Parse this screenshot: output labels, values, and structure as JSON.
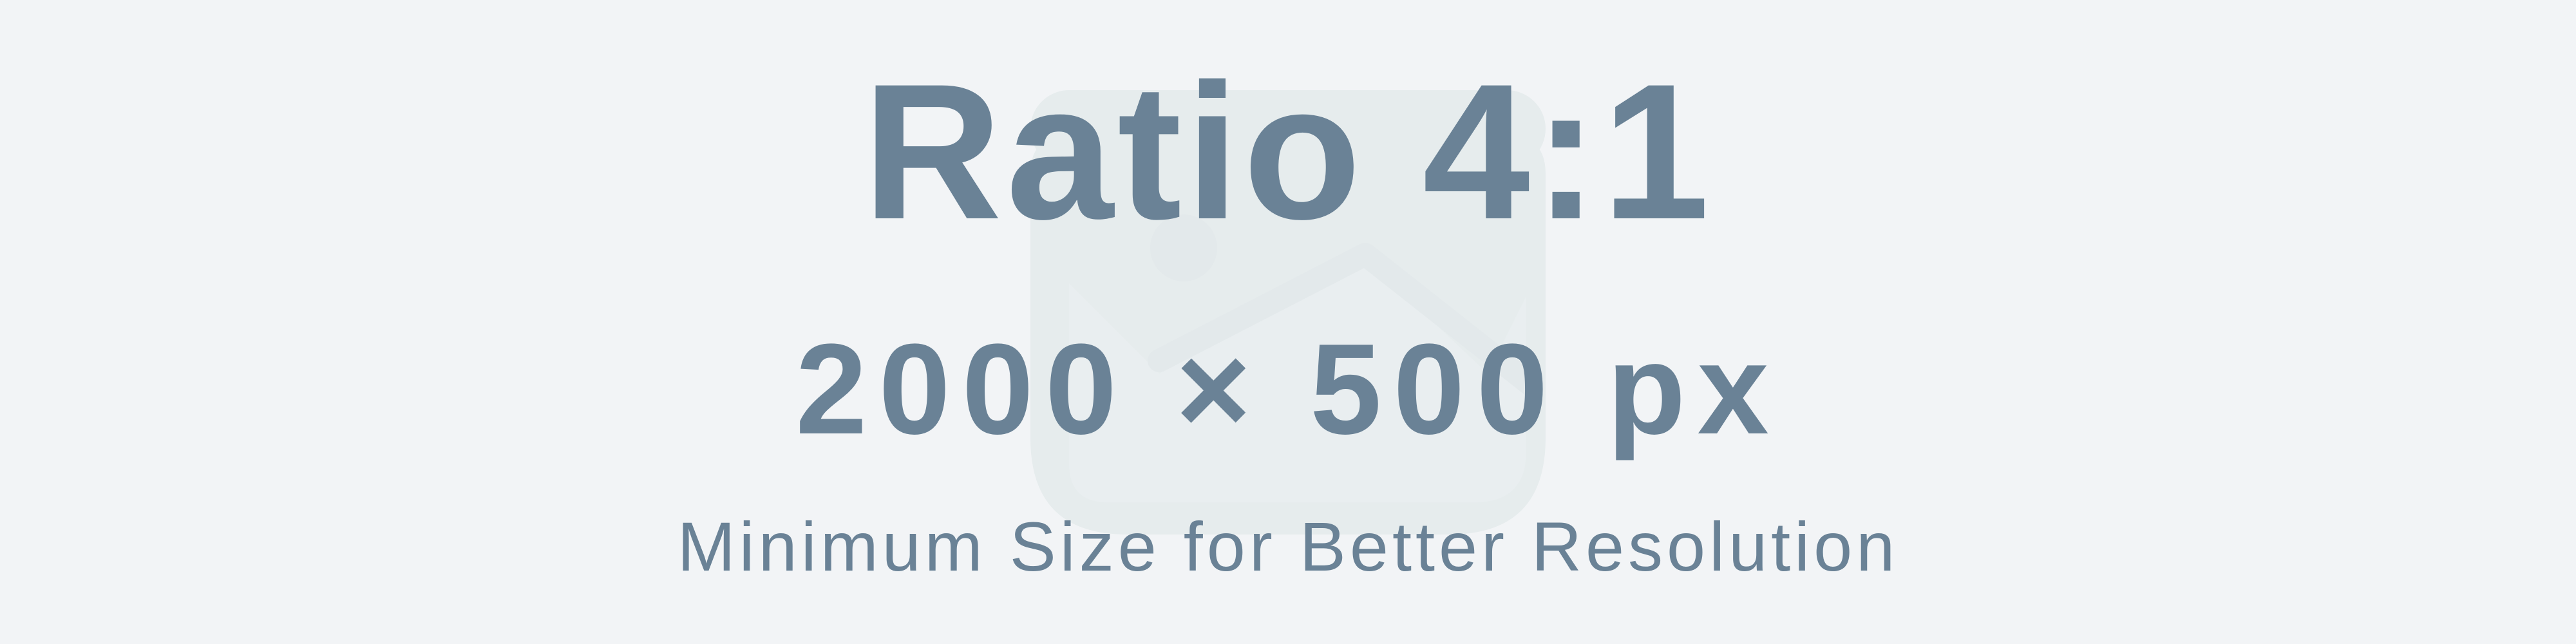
{
  "title": "Ratio 4:1",
  "dimensions": "2000 × 500 px",
  "subtitle": "Minimum Size for Better Resolution",
  "background_icon": "image-placeholder-icon",
  "colors": {
    "background": "#f2f4f6",
    "text": "#6a8296",
    "icon": "#e6eced"
  }
}
